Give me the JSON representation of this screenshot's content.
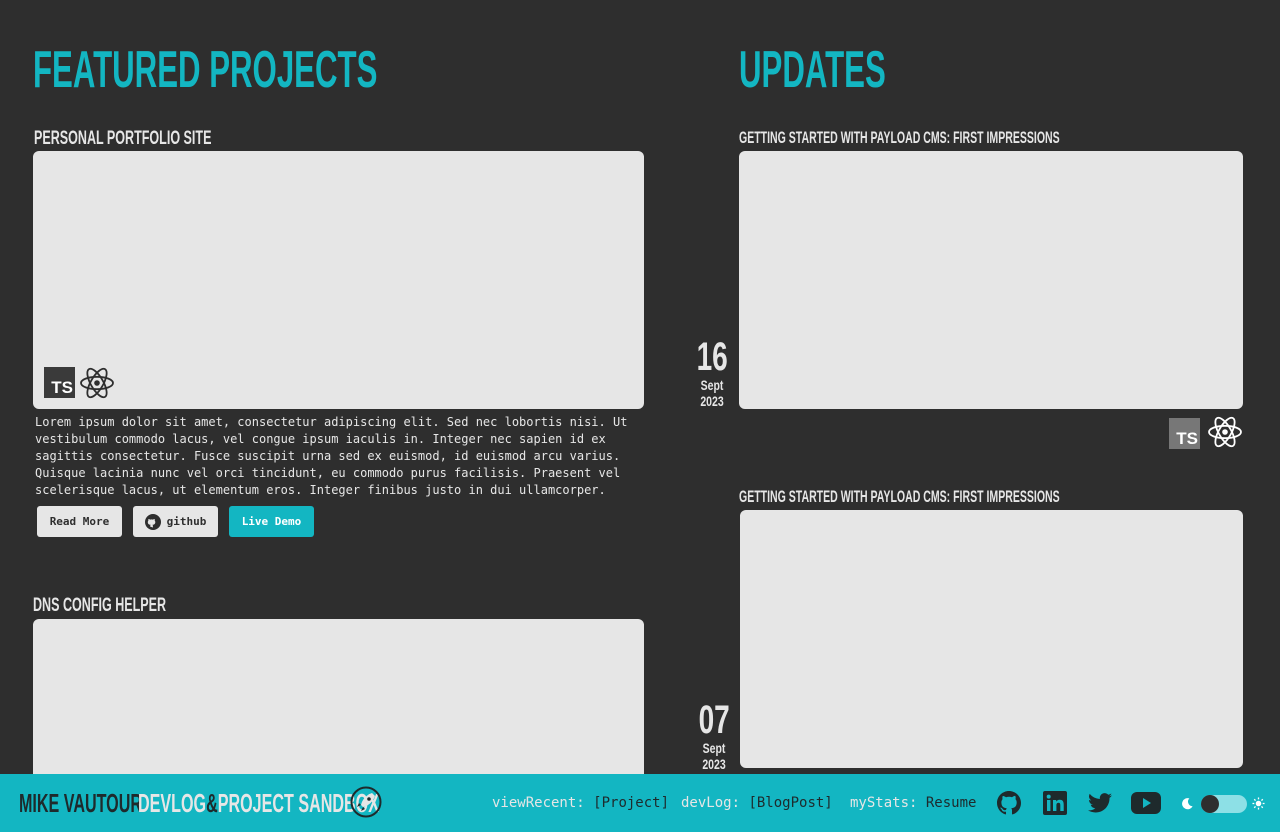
{
  "featured": {
    "heading": "Featured Projects",
    "projects": [
      {
        "title": "Personal Portfolio Site",
        "tech_icons": [
          "typescript-icon",
          "react-icon"
        ],
        "description": "Lorem ipsum dolor sit amet, consectetur adipiscing elit. Sed nec lobortis nisi. Ut vestibulum commodo lacus, vel congue ipsum iaculis in. Integer nec sapien id ex sagittis consectetur. Fusce suscipit urna sed ex euismod, id euismod arcu varius. Quisque lacinia nunc vel orci tincidunt, eu commodo purus facilisis. Praesent vel scelerisque lacus, ut elementum eros. Integer finibus justo in dui ullamcorper.",
        "buttons": {
          "read_more": "Read More",
          "github": "github",
          "live_demo": "Live Demo"
        }
      },
      {
        "title": "DNS Config Helper"
      }
    ]
  },
  "updates": {
    "heading": "Updates",
    "posts": [
      {
        "title": "Getting Started with Payload CMS: First Impressions",
        "day": "16",
        "month": "Sept",
        "year": "2023",
        "tech_icons": [
          "typescript-icon",
          "react-icon"
        ]
      },
      {
        "title": "Getting Started with Payload CMS: First Impressions",
        "day": "07",
        "month": "Sept",
        "year": "2023"
      }
    ]
  },
  "footer": {
    "name": "Mike Vautour",
    "tagline_a": "Devlog",
    "tagline_amp": "&",
    "tagline_b": "Project Sandbox",
    "nav": [
      {
        "key": "viewRecent",
        "sep": ": ",
        "value": "[Project]"
      },
      {
        "key": "devLog",
        "sep": ": ",
        "value": "[BlogPost]"
      },
      {
        "key": "myStats",
        "sep": ": ",
        "value": "Resume"
      }
    ],
    "social_icons": [
      "github-icon",
      "linkedin-icon",
      "twitter-icon",
      "youtube-icon"
    ],
    "theme_toggle": "dark"
  },
  "colors": {
    "background": "#2e2e2e",
    "accent": "#13b6c2",
    "text": "#e6e6e6",
    "card": "#e6e6e6"
  }
}
